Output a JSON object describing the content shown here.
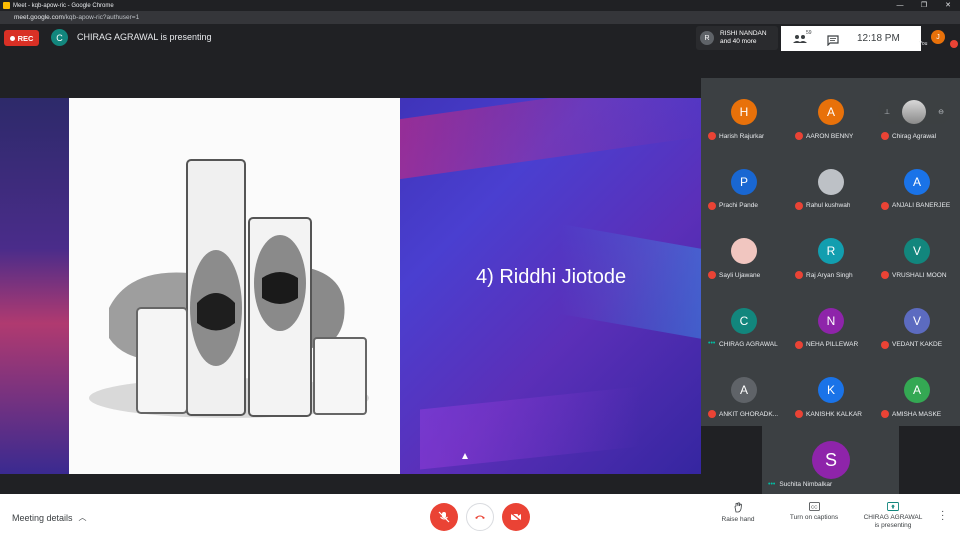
{
  "browser": {
    "title": "Meet - kqb-apow-ric - Google Chrome",
    "url_host": "meet.google.com",
    "url_path": "/kqb-apow-ric?authuser=1"
  },
  "top": {
    "rec_label": "REC",
    "presenter_initial": "C",
    "presenting_text": "CHIRAG AGRAWAL is presenting",
    "others_initial": "R",
    "others_line1": "RISHI NANDAN",
    "others_line2": "and 40 more",
    "people_count": "59",
    "time": "12:18 PM",
    "you_initial": "J",
    "you_label": "You"
  },
  "slide": {
    "title": "4) Riddhi Jiotode"
  },
  "participants": [
    {
      "initial": "H",
      "name": "Harish Rajurkar",
      "color": "#e8710a",
      "status": "muted"
    },
    {
      "initial": "A",
      "name": "AARON BENNY",
      "color": "#e8710a",
      "status": "muted"
    },
    {
      "initial": "",
      "name": "Chirag Agrawal",
      "color": "#5f6368",
      "status": "muted"
    },
    {
      "initial": "P",
      "name": "Prachi Pande",
      "color": "#1967d2",
      "status": "muted"
    },
    {
      "initial": "",
      "name": "Rahul kushwah",
      "color": "#bdc1c6",
      "status": "muted"
    },
    {
      "initial": "A",
      "name": "ANJALI BANERJEE",
      "color": "#1a73e8",
      "status": "muted"
    },
    {
      "initial": "",
      "name": "Sayli Ujawane",
      "color": "#f1c6c0",
      "status": "muted"
    },
    {
      "initial": "R",
      "name": "Raj Aryan Singh",
      "color": "#129eaf",
      "status": "muted"
    },
    {
      "initial": "V",
      "name": "VRUSHALI MOON",
      "color": "#12867d",
      "status": "muted"
    },
    {
      "initial": "C",
      "name": "CHIRAG AGRAWAL",
      "color": "#12867d",
      "status": "speaking"
    },
    {
      "initial": "N",
      "name": "NEHA PILLEWAR",
      "color": "#8e24aa",
      "status": "muted"
    },
    {
      "initial": "V",
      "name": "VEDANT KAKDE",
      "color": "#5c6bc0",
      "status": "muted"
    },
    {
      "initial": "A",
      "name": "ANKIT GHORADK...",
      "color": "#5f6368",
      "status": "muted"
    },
    {
      "initial": "K",
      "name": "KANISHK KALKAR",
      "color": "#1a73e8",
      "status": "muted"
    },
    {
      "initial": "A",
      "name": "AMISHA MASKE",
      "color": "#34a853",
      "status": "muted"
    }
  ],
  "last_tile": {
    "initial": "S",
    "name": "Suchita Nimbalkar"
  },
  "bottom": {
    "meeting_details": "Meeting details",
    "raise_hand": "Raise hand",
    "captions": "Turn on captions",
    "presenting_line1": "CHIRAG AGRAWAL",
    "presenting_line2": "is presenting"
  }
}
